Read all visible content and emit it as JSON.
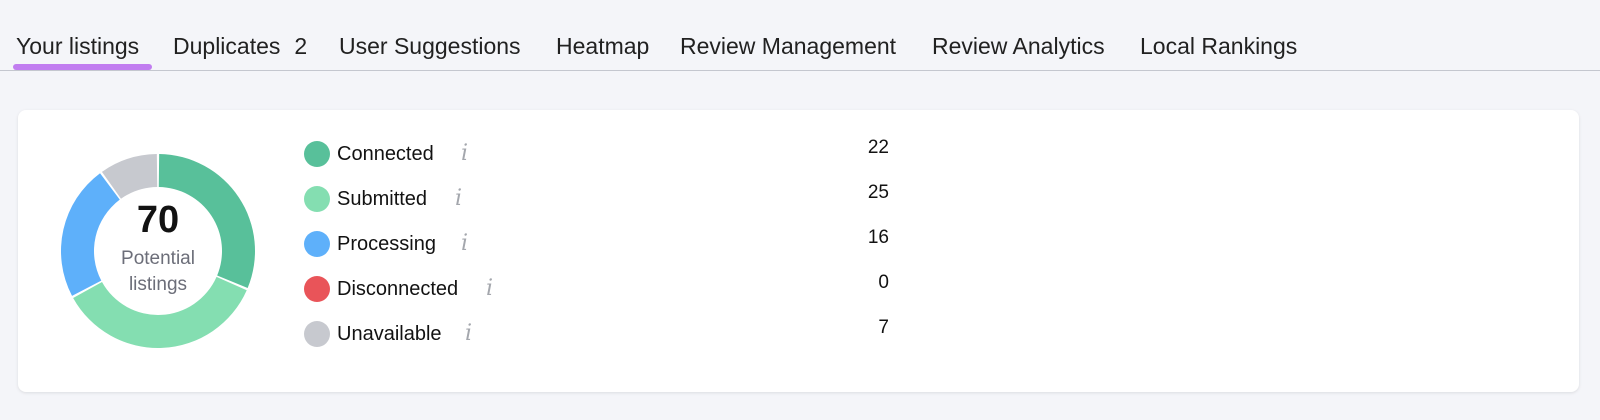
{
  "tabs": [
    {
      "label": "Your listings",
      "active": true
    },
    {
      "label": "Duplicates",
      "count": "2"
    },
    {
      "label": "User Suggestions"
    },
    {
      "label": "Heatmap"
    },
    {
      "label": "Review Management"
    },
    {
      "label": "Review Analytics"
    },
    {
      "label": "Local Rankings"
    }
  ],
  "accent_color": "#c17df0",
  "summary": {
    "total": "70",
    "caption_line1": "Potential",
    "caption_line2": "listings"
  },
  "chart_data": {
    "type": "pie",
    "variant": "donut",
    "categories": [
      "Connected",
      "Submitted",
      "Processing",
      "Disconnected",
      "Unavailable"
    ],
    "values": [
      22,
      25,
      16,
      0,
      7
    ],
    "colors": [
      "#58c09a",
      "#84deb1",
      "#5eb0fa",
      "#e95459",
      "#c7c9cf"
    ],
    "total": 70,
    "legend": "right"
  },
  "legend": [
    {
      "label": "Connected",
      "value": "22",
      "color": "#58c09a",
      "icon": "info-icon"
    },
    {
      "label": "Submitted",
      "value": "25",
      "color": "#84deb1",
      "icon": "info-icon"
    },
    {
      "label": "Processing",
      "value": "16",
      "color": "#5eb0fa",
      "icon": "info-icon"
    },
    {
      "label": "Disconnected",
      "value": "0",
      "color": "#e95459",
      "icon": "info-icon"
    },
    {
      "label": "Unavailable",
      "value": "7",
      "color": "#c7c9cf",
      "icon": "info-icon"
    }
  ]
}
